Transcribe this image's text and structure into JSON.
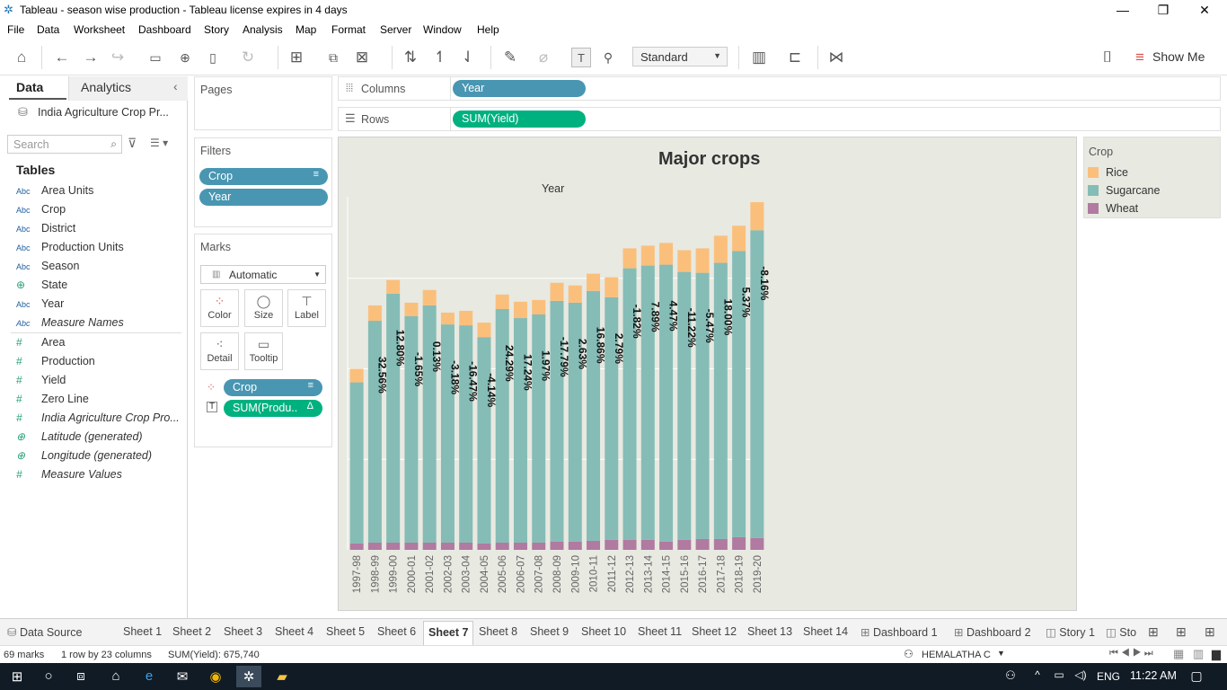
{
  "window": {
    "title": "Tableau - season wise production - Tableau license expires in 4 days"
  },
  "menu": [
    "File",
    "Data",
    "Worksheet",
    "Dashboard",
    "Story",
    "Analysis",
    "Map",
    "Format",
    "Server",
    "Window",
    "Help"
  ],
  "toolbar": {
    "fit_value": "Standard",
    "show_me_label": "Show Me"
  },
  "left_pane": {
    "tab_data": "Data",
    "tab_analytics": "Analytics",
    "datasource": "India Agriculture Crop Pr...",
    "search_placeholder": "Search",
    "tables_label": "Tables",
    "dimensions": [
      {
        "type": "Abc",
        "name": "Area Units"
      },
      {
        "type": "Abc",
        "name": "Crop"
      },
      {
        "type": "Abc",
        "name": "District"
      },
      {
        "type": "Abc",
        "name": "Production Units"
      },
      {
        "type": "Abc",
        "name": "Season"
      },
      {
        "type": "geo",
        "name": "State"
      },
      {
        "type": "Abc",
        "name": "Year"
      },
      {
        "type": "Abc",
        "name": "Measure Names"
      }
    ],
    "measures": [
      {
        "type": "#",
        "name": "Area"
      },
      {
        "type": "#",
        "name": "Production"
      },
      {
        "type": "#",
        "name": "Yield"
      },
      {
        "type": "#",
        "name": "Zero Line"
      },
      {
        "type": "#",
        "name": "India Agriculture Crop Pro..."
      },
      {
        "type": "geo",
        "name": "Latitude (generated)"
      },
      {
        "type": "geo",
        "name": "Longitude (generated)"
      },
      {
        "type": "#",
        "name": "Measure Values"
      }
    ]
  },
  "shelves": {
    "pages_label": "Pages",
    "filters_label": "Filters",
    "filters": [
      "Crop",
      "Year"
    ],
    "marks_label": "Marks",
    "mark_type": "Automatic",
    "mark_buttons": [
      "Color",
      "Size",
      "Label",
      "Detail",
      "Tooltip"
    ],
    "mark_pills": [
      "Crop",
      "SUM(Produ.."
    ],
    "columns_label": "Columns",
    "columns_pill": "Year",
    "rows_label": "Rows",
    "rows_pill": "SUM(Yield)"
  },
  "legend": {
    "title": "Crop",
    "items": [
      {
        "name": "Rice",
        "color": "#fbbf7c"
      },
      {
        "name": "Sugarcane",
        "color": "#85bcb6"
      },
      {
        "name": "Wheat",
        "color": "#b07aa1"
      }
    ]
  },
  "chart_data": {
    "type": "bar",
    "title": "Major crops",
    "xlabel": "Year",
    "ylabel": "",
    "stacked": true,
    "categories": [
      "1997-98",
      "1998-99",
      "1999-00",
      "2000-01",
      "2001-02",
      "2002-03",
      "2003-04",
      "2004-05",
      "2005-06",
      "2006-07",
      "2007-08",
      "2008-09",
      "2009-10",
      "2010-11",
      "2011-12",
      "2012-13",
      "2013-14",
      "2014-15",
      "2015-16",
      "2016-17",
      "2017-18",
      "2018-19",
      "2019-20"
    ],
    "series": [
      {
        "name": "Wheat",
        "color": "#b07aa1",
        "values": [
          7,
          8,
          8,
          8,
          8,
          8,
          8,
          7,
          8,
          8,
          8,
          9,
          9,
          10,
          11,
          11,
          11,
          9,
          11,
          12,
          12,
          14,
          13
        ]
      },
      {
        "name": "Sugarcane",
        "color": "#85bcb6",
        "values": [
          178,
          245,
          275,
          250,
          262,
          241,
          240,
          228,
          258,
          248,
          252,
          266,
          264,
          276,
          268,
          300,
          303,
          306,
          296,
          294,
          305,
          316,
          340
        ]
      },
      {
        "name": "Rice",
        "color": "#fbbf7c",
        "values": [
          15,
          17,
          15,
          15,
          17,
          13,
          16,
          16,
          16,
          18,
          16,
          20,
          19,
          19,
          22,
          22,
          22,
          24,
          24,
          27,
          30,
          28,
          31
        ]
      }
    ],
    "labels": [
      "",
      "32.56%",
      "12.80%",
      "-1.65%",
      "0.13%",
      "-3.18%",
      "-16.47%",
      "-4.14%",
      "24.29%",
      "17.24%",
      "1.97%",
      "-17.79%",
      "2.63%",
      "16.86%",
      "2.79%",
      "-1.82%",
      "7.89%",
      "4.47%",
      "-11.22%",
      "-5.47%",
      "18.00%",
      "5.37%",
      "-8.16%"
    ],
    "ylim": [
      0,
      390
    ],
    "grid": true
  },
  "sheet_tabs": [
    "Data Source",
    "Sheet 1",
    "Sheet 2",
    "Sheet 3",
    "Sheet 4",
    "Sheet 5",
    "Sheet 6",
    "Sheet 7",
    "Sheet 8",
    "Sheet 9",
    "Sheet 10",
    "Sheet 11",
    "Sheet 12",
    "Sheet 13",
    "Sheet 14",
    "Dashboard 1",
    "Dashboard 2",
    "Story 1",
    "Sto"
  ],
  "status": {
    "marks": "69 marks",
    "dims": "1 row by 23 columns",
    "sum": "SUM(Yield): 675,740",
    "user": "HEMALATHA C"
  },
  "taskbar": {
    "lang": "ENG",
    "time": "11:22 AM"
  }
}
